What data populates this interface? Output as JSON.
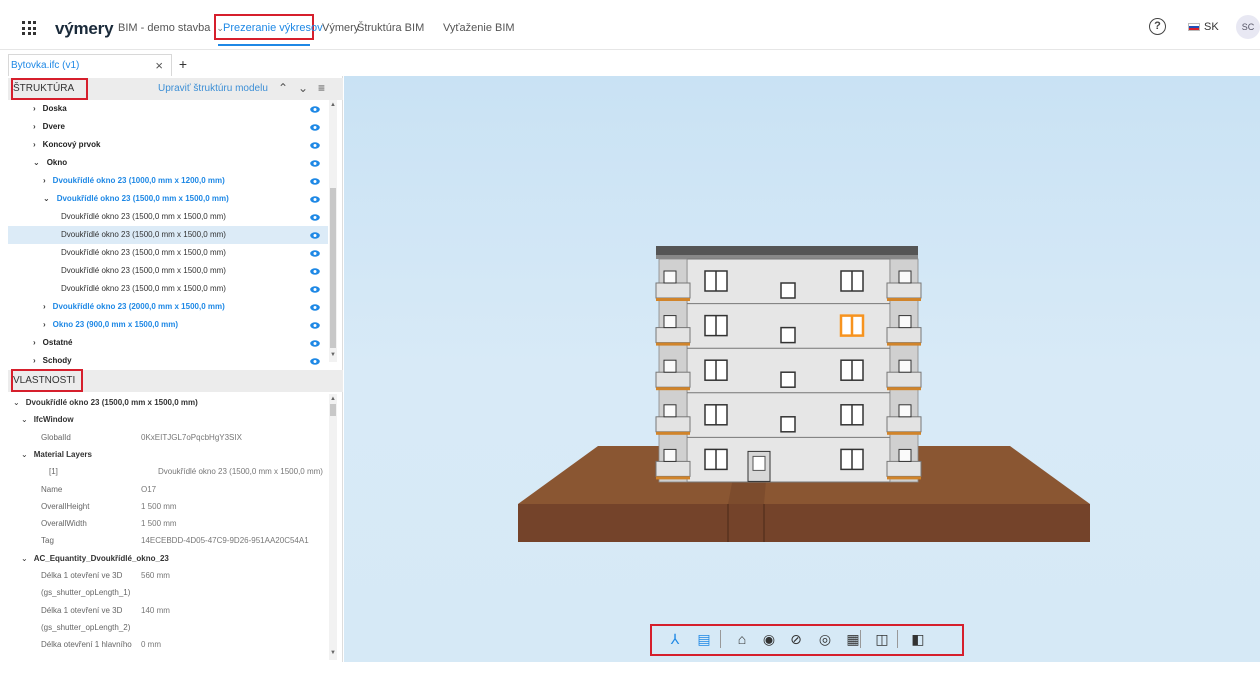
{
  "topbar": {
    "brand": "výmery",
    "project": "BIM - demo stavba",
    "nav_active": "Prezeranie výkresov",
    "nav_items": [
      "Výmery",
      "Štruktúra BIM",
      "Vyťaženie BIM"
    ],
    "help": "?",
    "language": "SK",
    "avatar": "SC"
  },
  "tabs": {
    "file_tab": "Bytovka.ifc (v1)",
    "close": "×",
    "add": "+"
  },
  "structure": {
    "title": "ŠTRUKTÚRA",
    "edit_link": "Upraviť štruktúru modelu",
    "items": [
      {
        "label": "Doska",
        "level": 0,
        "state": "collapsed",
        "style": "group"
      },
      {
        "label": "Dvere",
        "level": 0,
        "state": "collapsed",
        "style": "group"
      },
      {
        "label": "Koncový prvok",
        "level": 0,
        "state": "collapsed",
        "style": "group"
      },
      {
        "label": "Okno",
        "level": 0,
        "state": "expanded",
        "style": "group"
      },
      {
        "label": "Dvoukřídlé okno 23 (1000,0 mm x 1200,0 mm)",
        "level": 1,
        "state": "collapsed",
        "style": "type"
      },
      {
        "label": "Dvoukřídlé okno 23 (1500,0 mm x 1500,0 mm)",
        "level": 1,
        "state": "expanded",
        "style": "type"
      },
      {
        "label": "Dvoukřídlé okno 23 (1500,0 mm x 1500,0 mm)",
        "level": 2,
        "state": "leaf",
        "style": "leaf"
      },
      {
        "label": "Dvoukřídlé okno 23 (1500,0 mm x 1500,0 mm)",
        "level": 2,
        "state": "leaf",
        "style": "leaf",
        "selected": true
      },
      {
        "label": "Dvoukřídlé okno 23 (1500,0 mm x 1500,0 mm)",
        "level": 2,
        "state": "leaf",
        "style": "leaf"
      },
      {
        "label": "Dvoukřídlé okno 23 (1500,0 mm x 1500,0 mm)",
        "level": 2,
        "state": "leaf",
        "style": "leaf"
      },
      {
        "label": "Dvoukřídlé okno 23 (1500,0 mm x 1500,0 mm)",
        "level": 2,
        "state": "leaf",
        "style": "leaf"
      },
      {
        "label": "Dvoukřídlé okno 23 (2000,0 mm x 1500,0 mm)",
        "level": 1,
        "state": "collapsed",
        "style": "type"
      },
      {
        "label": "Okno 23 (900,0 mm x 1500,0 mm)",
        "level": 1,
        "state": "collapsed",
        "style": "type"
      },
      {
        "label": "Ostatné",
        "level": 0,
        "state": "collapsed",
        "style": "group"
      },
      {
        "label": "Schody",
        "level": 0,
        "state": "collapsed",
        "style": "group"
      }
    ]
  },
  "properties": {
    "title": "VLASTNOSTI",
    "rows": [
      {
        "kind": "group",
        "level": 0,
        "label": "Dvoukřídlé okno 23 (1500,0 mm x 1500,0 mm)",
        "value": ""
      },
      {
        "kind": "group",
        "level": 1,
        "label": "IfcWindow",
        "value": ""
      },
      {
        "kind": "prop",
        "level": 2,
        "label": "GlobalId",
        "value": "0KxEITJGL7oPqcbHgY3SIX"
      },
      {
        "kind": "group",
        "level": 1,
        "label": "Material Layers",
        "value": ""
      },
      {
        "kind": "prop",
        "level": 3,
        "label": "[1]",
        "value": "Dvoukřídlé okno 23 (1500,0 mm x 1500,0 mm)"
      },
      {
        "kind": "prop",
        "level": 2,
        "label": "Name",
        "value": "O17"
      },
      {
        "kind": "prop",
        "level": 2,
        "label": "OverallHeight",
        "value": "1 500 mm"
      },
      {
        "kind": "prop",
        "level": 2,
        "label": "OverallWidth",
        "value": "1 500 mm"
      },
      {
        "kind": "prop",
        "level": 2,
        "label": "Tag",
        "value": "14ECEBDD-4D05-47C9-9D26-951AA20C54A1"
      },
      {
        "kind": "group",
        "level": 1,
        "label": "AC_Equantity_Dvoukřídlé_okno_23",
        "value": ""
      },
      {
        "kind": "prop",
        "level": 2,
        "label": "Délka 1 otevření ve 3D",
        "value": "560 mm"
      },
      {
        "kind": "prop",
        "level": 2,
        "label": "(gs_shutter_opLength_1)",
        "value": ""
      },
      {
        "kind": "prop",
        "level": 2,
        "label": "Délka 1 otevření ve 3D",
        "value": "140 mm"
      },
      {
        "kind": "prop",
        "level": 2,
        "label": "(gs_shutter_opLength_2)",
        "value": ""
      },
      {
        "kind": "prop",
        "level": 2,
        "label": "Délka otevření 1 hlavního",
        "value": "0 mm"
      }
    ]
  },
  "toolbar": {
    "icons": [
      "structure-tree-icon",
      "properties-list-icon",
      "home-view-icon",
      "show-all-icon",
      "hide-selected-icon",
      "isolate-icon",
      "hide-spaces-icon",
      "section-plane-icon",
      "clipping-box-icon"
    ]
  },
  "colors": {
    "accent": "#1e88e5",
    "highlight_box": "#d61f2c",
    "selected_window": "#f7931e",
    "terrain": "#7a4a2a"
  }
}
